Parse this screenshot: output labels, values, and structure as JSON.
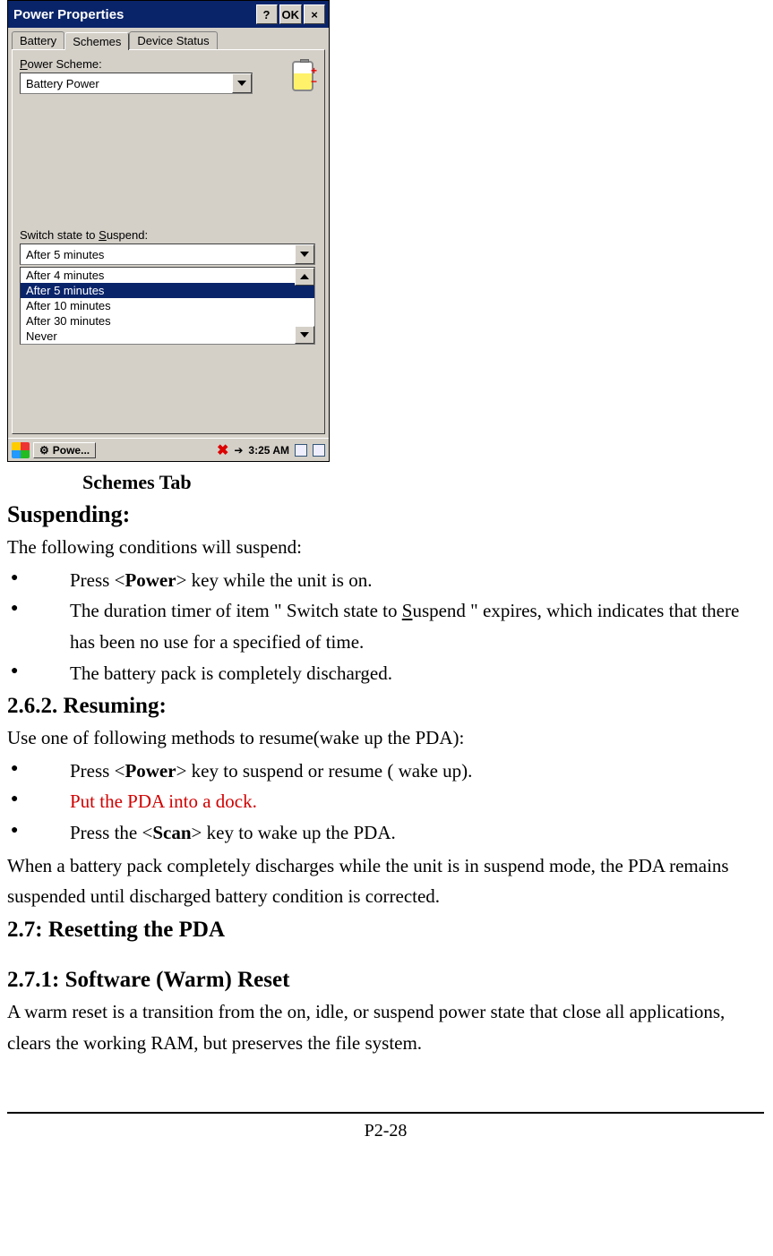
{
  "screenshot": {
    "window_title": "Power Properties",
    "help_btn": "?",
    "ok_btn": "OK",
    "close_btn": "×",
    "tabs": [
      "Battery",
      "Schemes",
      "Device Status"
    ],
    "active_tab_index": 1,
    "power_scheme_label_prefix": "P",
    "power_scheme_label_rest": "ower Scheme:",
    "power_scheme_value": "Battery Power",
    "suspend_label_pre": "Switch state to ",
    "suspend_label_u": "S",
    "suspend_label_post": "uspend:",
    "suspend_value": "After 5 minutes",
    "options": [
      "After 4 minutes",
      "After 5 minutes",
      "After 10 minutes",
      "After 30 minutes",
      "Never"
    ],
    "selected_option_index": 1,
    "taskbar_app": "Powe...",
    "clock": "3:25 AM"
  },
  "doc": {
    "caption": "Schemes Tab",
    "suspending_heading": "Suspending:",
    "suspending_intro": "The following conditions will suspend:",
    "suspend_bullets_pre1": "Press <",
    "suspend_bullets_power": "Power",
    "suspend_bullets_post1": "> key while the unit is on.",
    "suspend_bullet2_a": "The duration timer of item \" Switch state to ",
    "suspend_bullet2_s": "S",
    "suspend_bullet2_b": "uspend \" expires, which indicates that there has been no use for a specified of time.",
    "suspend_bullet3": "The battery pack is completely discharged.",
    "resuming_heading": "2.6.2. Resuming:",
    "resuming_intro": "Use one of following methods to resume(wake up the PDA):",
    "resume_bullet1_pre": "Press <",
    "resume_bullet1_power": "Power",
    "resume_bullet1_post": "> key to suspend or resume ( wake up).",
    "resume_bullet2": "Put the PDA into a dock.",
    "resume_bullet3_pre": "Press the <",
    "resume_bullet3_scan": "Scan",
    "resume_bullet3_post": "> key to wake up the PDA.",
    "resume_para": "When a battery pack completely discharges while the unit is in suspend mode, the PDA remains suspended until discharged battery condition is corrected.",
    "reset_heading": "2.7: Resetting the PDA",
    "warm_reset_heading": "2.7.1: Software (Warm) Reset",
    "warm_reset_para": "A warm reset is a transition from the on, idle, or suspend power state that close all applications, clears the working RAM, but preserves the file system.",
    "page_number": "P2-28"
  }
}
